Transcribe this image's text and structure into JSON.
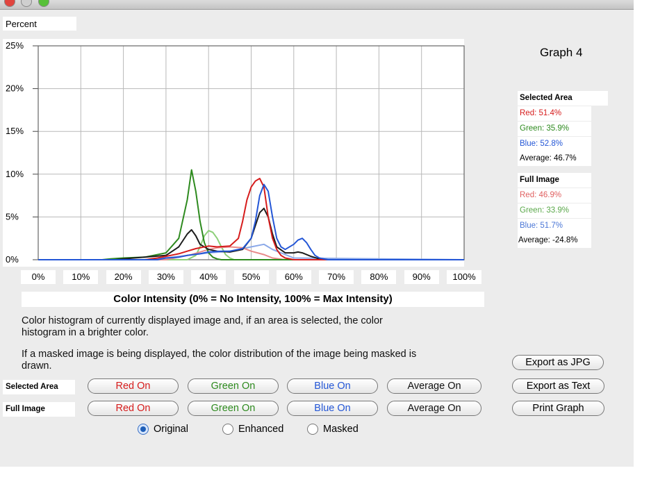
{
  "graph_title": "Graph 4",
  "chart_data": {
    "type": "line",
    "ylabel": "Percent",
    "xlabel": "Color Intensity (0% = No Intensity, 100% = Max Intensity)",
    "x_ticks": [
      "0%",
      "10%",
      "20%",
      "30%",
      "40%",
      "50%",
      "60%",
      "70%",
      "80%",
      "90%",
      "100%"
    ],
    "y_ticks": [
      "0%",
      "5%",
      "10%",
      "15%",
      "20%",
      "25%"
    ],
    "xlim": [
      0,
      100
    ],
    "ylim": [
      0,
      25
    ],
    "grid": true,
    "series": [
      {
        "color": "#2d8a1e",
        "x": [
          0,
          15,
          17,
          20,
          25,
          30,
          33,
          35,
          36,
          37,
          38,
          39,
          40,
          41,
          42,
          43,
          44,
          45,
          50,
          60,
          100
        ],
        "y": [
          0,
          0,
          0.1,
          0.2,
          0.3,
          0.8,
          2.5,
          7.0,
          10.5,
          8.0,
          4.5,
          2.0,
          0.8,
          0.3,
          0.1,
          0,
          0,
          0,
          0,
          0,
          0
        ]
      },
      {
        "color": "#1c1c1c",
        "x": [
          0,
          18,
          20,
          25,
          30,
          33,
          35,
          36,
          37,
          38,
          40,
          42,
          45,
          48,
          50,
          51,
          52,
          53,
          54,
          55,
          56,
          58,
          60,
          61,
          62,
          64,
          66,
          68,
          100
        ],
        "y": [
          0,
          0,
          0.1,
          0.3,
          0.5,
          1.5,
          3.0,
          3.5,
          2.8,
          1.8,
          1.2,
          1.0,
          0.9,
          1.2,
          2.5,
          4.0,
          5.5,
          6.0,
          5.0,
          3.0,
          1.5,
          0.8,
          0.8,
          0.9,
          0.8,
          0.4,
          0.1,
          0,
          0
        ]
      },
      {
        "color": "#d61c1c",
        "x": [
          0,
          25,
          28,
          30,
          33,
          35,
          37,
          40,
          42,
          45,
          47,
          48,
          49,
          50,
          51,
          52,
          53,
          54,
          55,
          56,
          57,
          58,
          60,
          100
        ],
        "y": [
          0,
          0,
          0.2,
          0.4,
          0.7,
          1.0,
          1.3,
          1.6,
          1.5,
          1.6,
          2.5,
          4.5,
          7.0,
          8.5,
          9.2,
          9.5,
          8.5,
          5.0,
          2.5,
          1.2,
          0.5,
          0.2,
          0,
          0
        ]
      },
      {
        "color": "#2356d6",
        "x": [
          0,
          28,
          30,
          33,
          35,
          38,
          40,
          43,
          45,
          48,
          50,
          51,
          52,
          53,
          54,
          55,
          56,
          57,
          58,
          60,
          61,
          62,
          63,
          64,
          65,
          66,
          68,
          100
        ],
        "y": [
          0,
          0,
          0.2,
          0.3,
          0.5,
          0.7,
          0.9,
          1.0,
          1.0,
          1.3,
          2.5,
          4.5,
          7.5,
          8.8,
          8.0,
          5.0,
          2.5,
          1.5,
          1.2,
          1.8,
          2.3,
          2.5,
          2.0,
          1.2,
          0.5,
          0.2,
          0,
          0
        ]
      },
      {
        "color": "#8aa8e8",
        "x": [
          0,
          25,
          30,
          35,
          40,
          45,
          50,
          53,
          55,
          58,
          60,
          100
        ],
        "y": [
          0,
          0,
          0.2,
          0.5,
          0.8,
          1.0,
          1.5,
          1.8,
          1.2,
          0.6,
          0.2,
          0
        ]
      },
      {
        "color": "#8ccf78",
        "x": [
          0,
          35,
          37,
          38,
          39,
          40,
          41,
          42,
          43,
          44,
          45,
          46,
          48,
          100
        ],
        "y": [
          0,
          0,
          0.5,
          1.5,
          2.8,
          3.4,
          3.2,
          2.5,
          1.5,
          0.6,
          0.2,
          0,
          0,
          0
        ]
      },
      {
        "color": "#e88a8a",
        "x": [
          0,
          30,
          33,
          36,
          38,
          40,
          42,
          45,
          48,
          50,
          53,
          55,
          58,
          100
        ],
        "y": [
          0,
          0,
          0.3,
          0.6,
          0.9,
          1.2,
          1.4,
          1.5,
          1.4,
          1.0,
          0.6,
          0.2,
          0,
          0
        ]
      }
    ]
  },
  "selected_area": {
    "header": "Selected Area",
    "red": "Red: 51.4%",
    "green": "Green: 35.9%",
    "blue": "Blue: 52.8%",
    "average": "Average: 46.7%"
  },
  "full_image": {
    "header": "Full Image",
    "red": "Red: 46.9%",
    "green": "Green: 33.9%",
    "blue": "Blue: 51.7%",
    "average": "Average: -24.8%"
  },
  "description": {
    "line1": "Color histogram of currently displayed image and, if an area is selected, the color",
    "line2": "histogram in a brighter color.",
    "line3": "If a masked image is being displayed, the color distribution of the image being masked is",
    "line4": "drawn."
  },
  "buttons": {
    "export_jpg": "Export as JPG",
    "export_text": "Export as Text",
    "print_graph": "Print Graph"
  },
  "toggle_rows": {
    "selected_label": "Selected Area",
    "full_label": "Full Image",
    "red": "Red On",
    "green": "Green On",
    "blue": "Blue On",
    "average": "Average On"
  },
  "radio": {
    "options": [
      "Original",
      "Enhanced",
      "Masked"
    ],
    "selected": "Original"
  },
  "colors": {
    "red": "#d61c1c",
    "green": "#2d8a1e",
    "blue": "#2356d6",
    "black": "#1c1c1c",
    "light_red": "#e06060",
    "light_green": "#5aa84a",
    "light_blue": "#4a76d6"
  }
}
